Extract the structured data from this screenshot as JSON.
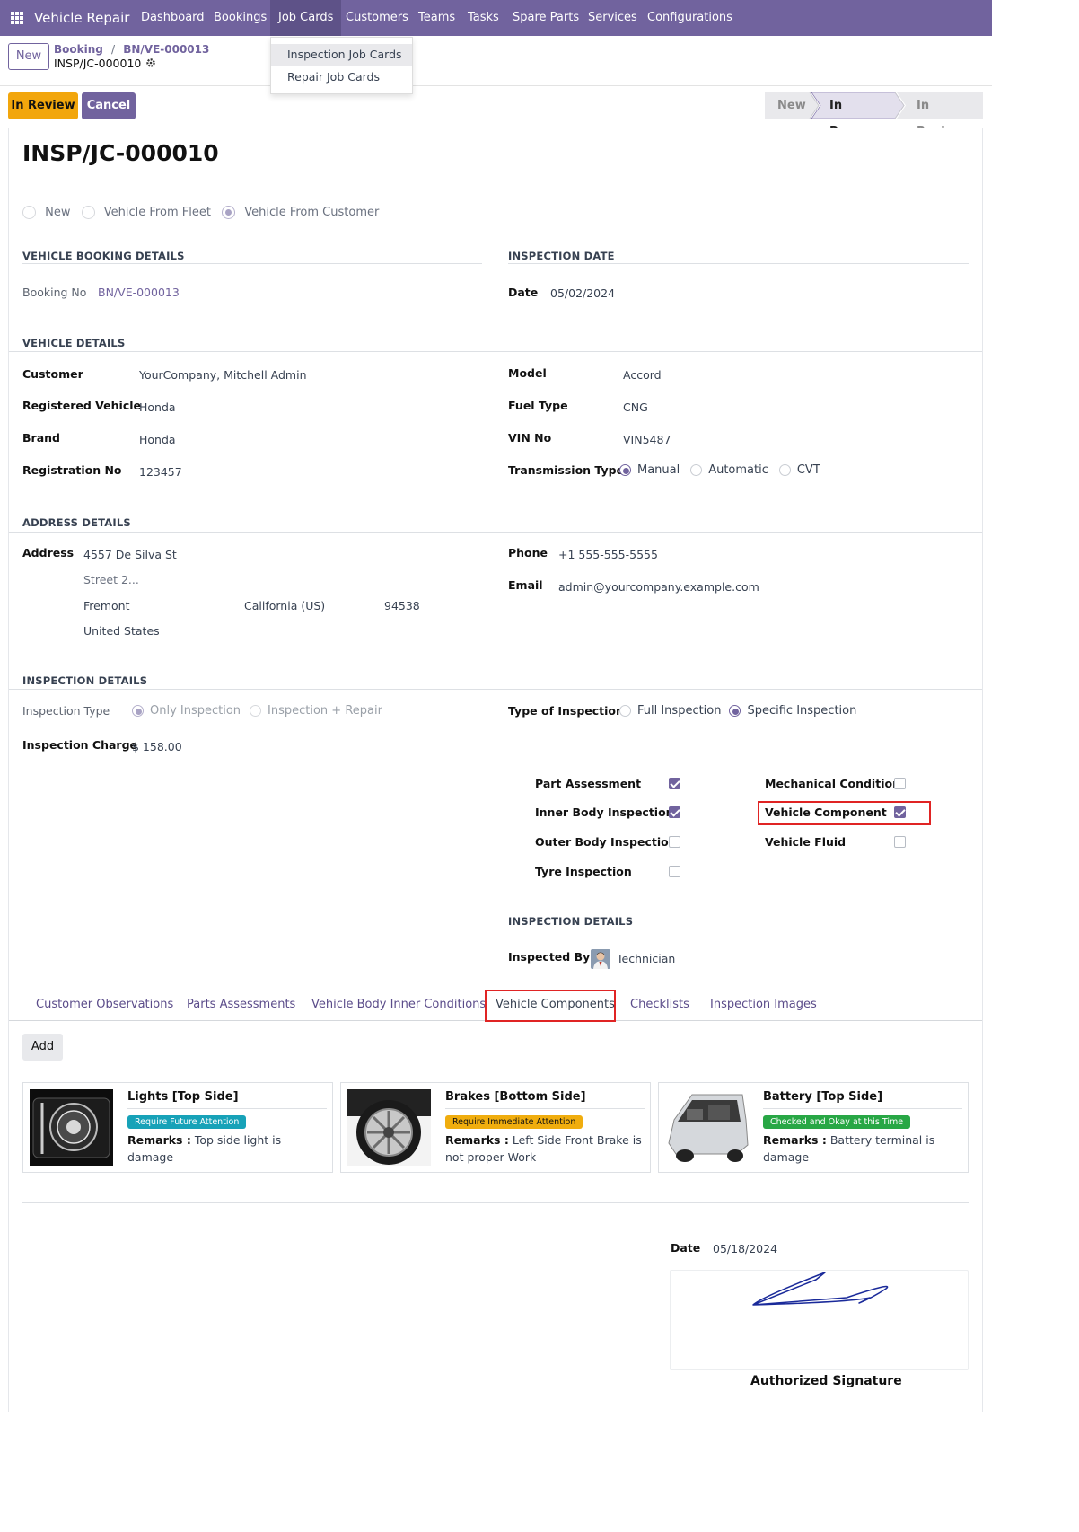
{
  "navbar": {
    "app_name": "Vehicle Repair",
    "menu": [
      "Dashboard",
      "Bookings",
      "Job Cards",
      "Customers",
      "Teams",
      "Tasks",
      "Spare Parts",
      "Services",
      "Configurations"
    ],
    "active_menu": "Job Cards",
    "dropdown": [
      "Inspection Job Cards",
      "Repair Job Cards"
    ]
  },
  "breadcrumb": {
    "new_label": "New",
    "parent": "Booking",
    "separator": "/",
    "parent_record": "BN/VE-000013",
    "current": "INSP/JC-000010"
  },
  "actions": {
    "in_review": "In Review",
    "cancel": "Cancel"
  },
  "status": {
    "steps": [
      "New",
      "In Progress",
      "In Review"
    ],
    "current": "In Progress"
  },
  "record": {
    "title": "INSP/JC-000010",
    "source_options": [
      "New",
      "Vehicle From Fleet",
      "Vehicle From Customer"
    ],
    "source_selected": "Vehicle From Customer"
  },
  "booking": {
    "section": "VEHICLE BOOKING DETAILS",
    "booking_no_label": "Booking No",
    "booking_no": "BN/VE-000013"
  },
  "inspection_date": {
    "section": "INSPECTION DATE",
    "date_label": "Date",
    "date": "05/02/2024"
  },
  "vehicle": {
    "section": "VEHICLE DETAILS",
    "customer_label": "Customer",
    "customer": "YourCompany, Mitchell Admin",
    "registered_label": "Registered Vehicle",
    "registered": "Honda",
    "brand_label": "Brand",
    "brand": "Honda",
    "regno_label": "Registration No",
    "regno": "123457",
    "model_label": "Model",
    "model": "Accord",
    "fuel_label": "Fuel Type",
    "fuel": "CNG",
    "vin_label": "VIN No",
    "vin": "VIN5487",
    "transmission_label": "Transmission Type",
    "transmission_options": [
      "Manual",
      "Automatic",
      "CVT"
    ],
    "transmission_selected": "Manual"
  },
  "address": {
    "section": "ADDRESS DETAILS",
    "address_label": "Address",
    "street": "4557 De Silva St",
    "street2_placeholder": "Street 2...",
    "city": "Fremont",
    "state": "California (US)",
    "zip": "94538",
    "country": "United States",
    "phone_label": "Phone",
    "phone": "+1 555-555-5555",
    "email_label": "Email",
    "email": "admin@yourcompany.example.com"
  },
  "inspection": {
    "section": "INSPECTION DETAILS",
    "type_label": "Inspection Type",
    "type_options": [
      "Only Inspection",
      "Inspection + Repair"
    ],
    "type_selected": "Only Inspection",
    "charge_label": "Inspection Charge",
    "charge": "$ 158.00",
    "kind_label": "Type of Inspection",
    "kind_options": [
      "Full Inspection",
      "Specific Inspection"
    ],
    "kind_selected": "Specific Inspection",
    "checks": [
      {
        "label": "Part Assessment",
        "checked": true
      },
      {
        "label": "Inner Body Inspection",
        "checked": true
      },
      {
        "label": "Outer Body Inspection",
        "checked": false
      },
      {
        "label": "Tyre Inspection",
        "checked": false
      },
      {
        "label": "Mechanical Condition",
        "checked": false
      },
      {
        "label": "Vehicle Component",
        "checked": true
      },
      {
        "label": "Vehicle Fluid",
        "checked": false
      }
    ],
    "details_section": "INSPECTION DETAILS",
    "inspected_by_label": "Inspected By",
    "inspected_by": "Technician"
  },
  "tabs": {
    "items": [
      "Customer Observations",
      "Parts Assessments",
      "Vehicle Body Inner Conditions",
      "Vehicle Components",
      "Checklists",
      "Inspection Images"
    ],
    "active": "Vehicle Components"
  },
  "components": {
    "add_label": "Add",
    "remarks_label": "Remarks :",
    "cards": [
      {
        "title": "Lights [Top Side]",
        "badge": "Require Future Attention",
        "badge_color": "#17a2b8",
        "remark": "Top side light is damage"
      },
      {
        "title": "Brakes [Bottom Side]",
        "badge": "Require Immediate Attention",
        "badge_color": "#f0ad0e",
        "remark": "Left Side Front Brake is not proper Work"
      },
      {
        "title": "Battery [Top Side]",
        "badge": "Checked and Okay at this Time",
        "badge_color": "#28a745",
        "remark": "Battery terminal is damage"
      }
    ]
  },
  "signature": {
    "date_label": "Date",
    "date": "05/18/2024",
    "label": "Authorized Signature"
  },
  "colors": {
    "brand": "#71639e",
    "warning": "#f2a60c",
    "highlight": "#e02424"
  }
}
